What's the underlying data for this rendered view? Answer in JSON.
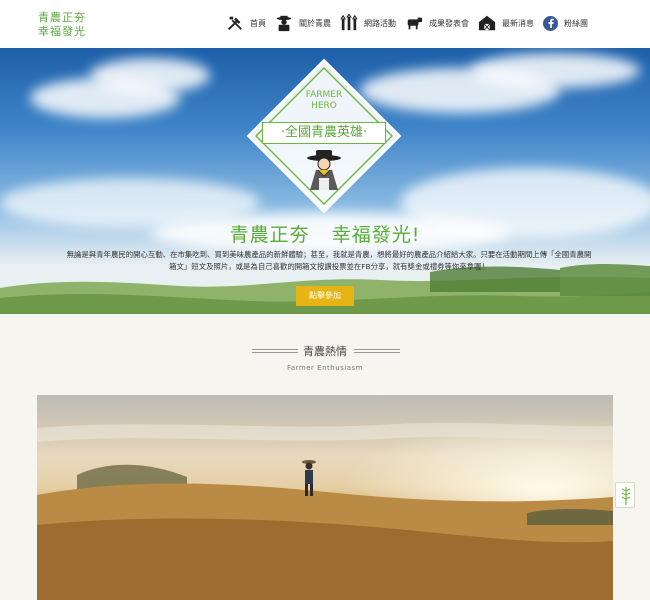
{
  "header": {
    "logo_line1": "青農正夯",
    "logo_line2": "幸福發光"
  },
  "nav": {
    "items": [
      {
        "label": "首頁",
        "icon": "farm-tools-icon"
      },
      {
        "label": "關於青農",
        "icon": "farmer-icon"
      },
      {
        "label": "網路活動",
        "icon": "crops-icon"
      },
      {
        "label": "成果發表會",
        "icon": "cow-icon"
      },
      {
        "label": "最新消息",
        "icon": "barn-icon"
      },
      {
        "label": "粉絲團",
        "icon": "facebook-icon"
      }
    ]
  },
  "hero": {
    "badge_line1": "FARMER",
    "badge_line2": "HERO",
    "badge_title": "·全國青農英雄·",
    "title_part1": "青農正夯",
    "title_part2": "幸福發光!",
    "desc_line1": "無論是與青年農民的開心互動、在市集吃到、買到美味農產品的新鮮體驗；甚至，我就是青農，想將最好的農產品介紹給大家。只要在活動期間上傳「全國青農開",
    "desc_line2": "箱文」短文及照片，或是為自己喜歡的開箱文按讚投票並在FB分享，就有獎金或禮券等你來拿喔！",
    "cta_label": "點擊參加"
  },
  "section": {
    "title": "青農熱情",
    "subtitle": "Farmer   Enthusiasm"
  },
  "colors": {
    "brand_green": "#5aa83c",
    "cta_yellow": "#e5b415",
    "facebook_blue": "#3b5998"
  }
}
